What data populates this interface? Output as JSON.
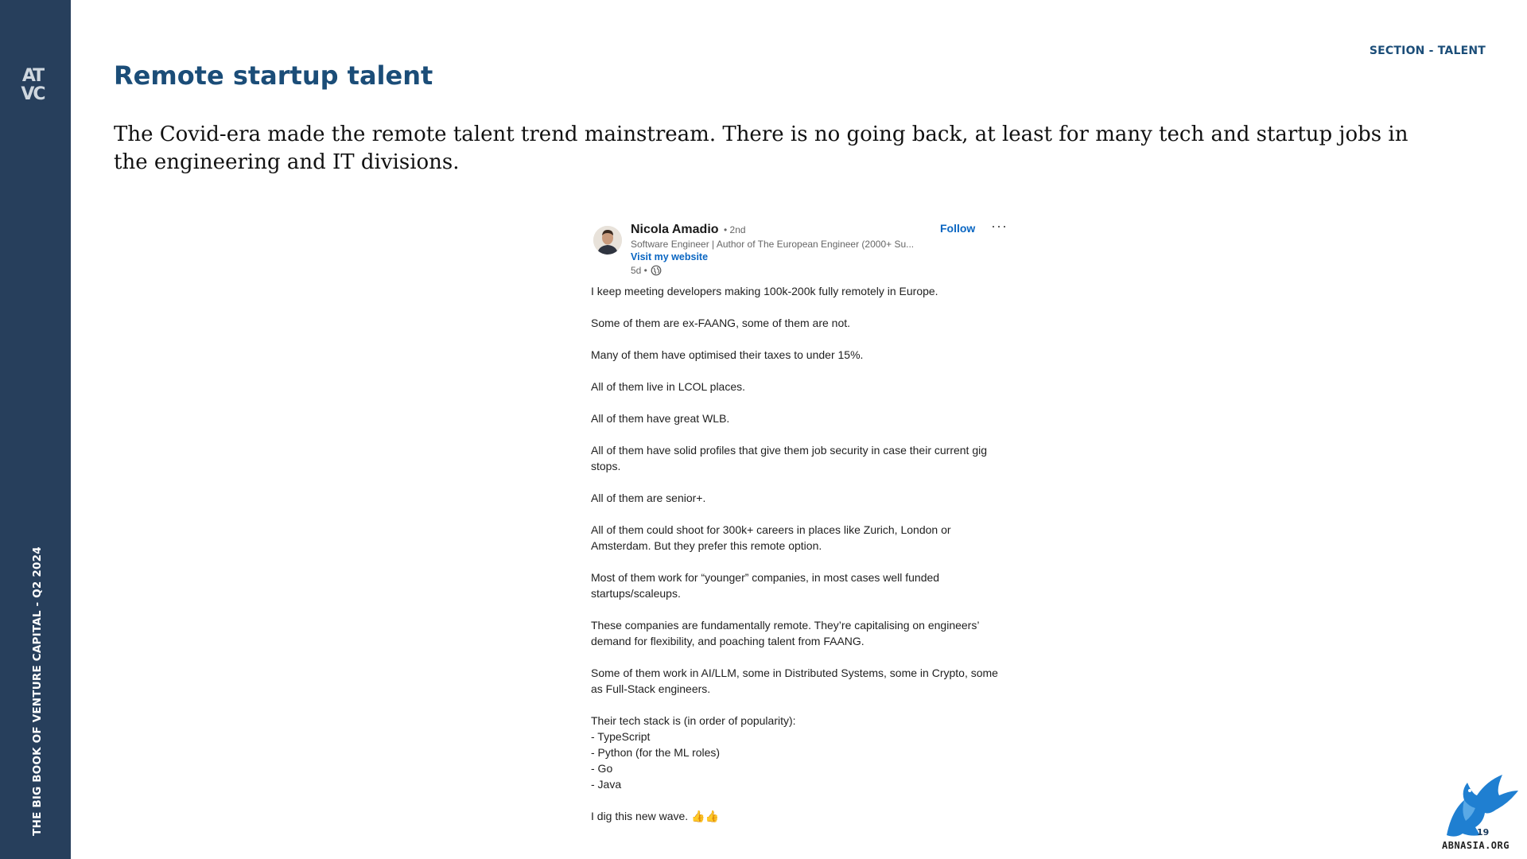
{
  "sidebar": {
    "logo_text": "ATVC",
    "vertical_label": "THE BIG BOOK OF VENTURE CAPITAL - Q2 2024"
  },
  "header": {
    "section_label": "SECTION - TALENT",
    "title": "Remote startup talent"
  },
  "intro": "The Covid-era made the remote talent trend mainstream. There is no going back, at least for many tech and startup jobs in the engineering and IT divisions.",
  "post": {
    "author": "Nicola Amadio",
    "degree": "• 2nd",
    "headline": "Software Engineer | Author of The European Engineer (2000+ Su...",
    "website_label": "Visit my website",
    "age": "5d •",
    "follow_label": "Follow",
    "more_label": "···",
    "paragraphs": [
      "I keep meeting developers making 100k-200k fully remotely in Europe.",
      "Some of them are ex-FAANG, some of them are not.",
      "Many of them have optimised their taxes to under 15%.",
      "All of them live in LCOL places.",
      "All of them have great WLB.",
      "All of them have solid profiles that give them job security in case their current gig stops.",
      "All of them are senior+.",
      "All of them could shoot for 300k+ careers in places like Zurich, London or Amsterdam. But they prefer this remote option.",
      "Most of them work for “younger” companies, in most cases well funded startups/scaleups.",
      "These companies are fundamentally remote. They’re capitalising on engineers’ demand for flexibility, and poaching talent from FAANG.",
      "Some of them work in AI/LLM, some in Distributed Systems, some in Crypto, some as Full-Stack engineers."
    ],
    "stack_intro": "Their tech stack is (in order of popularity):",
    "stack_items": [
      "- TypeScript",
      "- Python (for the ML roles)",
      "- Go",
      "- Java"
    ],
    "closing": "I dig this new wave. 👍👍"
  },
  "watermark": {
    "text": "ABNASIA.ORG",
    "badge": "19"
  },
  "colors": {
    "sidebar_bg": "#273f5c",
    "title": "#1b4d78",
    "link": "#0a66c2",
    "eagle": "#1f7fd1"
  }
}
